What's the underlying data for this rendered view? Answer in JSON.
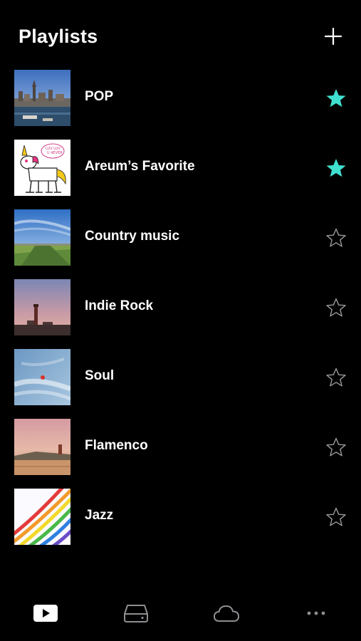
{
  "header": {
    "title": "Playlists"
  },
  "colors": {
    "background": "#000000",
    "text": "#ffffff",
    "favorite_star": "#3fe0cf",
    "empty_star": "#9a9a9a",
    "tab_active": "#ffffff",
    "tab_inactive": "#8e8e93"
  },
  "playlists": [
    {
      "name": "POP",
      "favorite": true,
      "thumb_icon": "city-harbor-photo"
    },
    {
      "name": "Areum’s Favorite",
      "favorite": true,
      "thumb_icon": "unicorn-drawing"
    },
    {
      "name": "Country music",
      "favorite": false,
      "thumb_icon": "countryside-photo"
    },
    {
      "name": "Indie Rock",
      "favorite": false,
      "thumb_icon": "lighthouse-dusk-photo"
    },
    {
      "name": "Soul",
      "favorite": false,
      "thumb_icon": "sky-clouds-photo"
    },
    {
      "name": "Flamenco",
      "favorite": false,
      "thumb_icon": "lighthouse-sunset-photo"
    },
    {
      "name": "Jazz",
      "favorite": false,
      "thumb_icon": "rainbow-drawing"
    }
  ],
  "tabs": [
    {
      "name": "playlists",
      "icon": "play-icon",
      "active": true
    },
    {
      "name": "storage",
      "icon": "drive-icon",
      "active": false
    },
    {
      "name": "cloud",
      "icon": "cloud-icon",
      "active": false
    },
    {
      "name": "more",
      "icon": "more-icon",
      "active": false
    }
  ]
}
